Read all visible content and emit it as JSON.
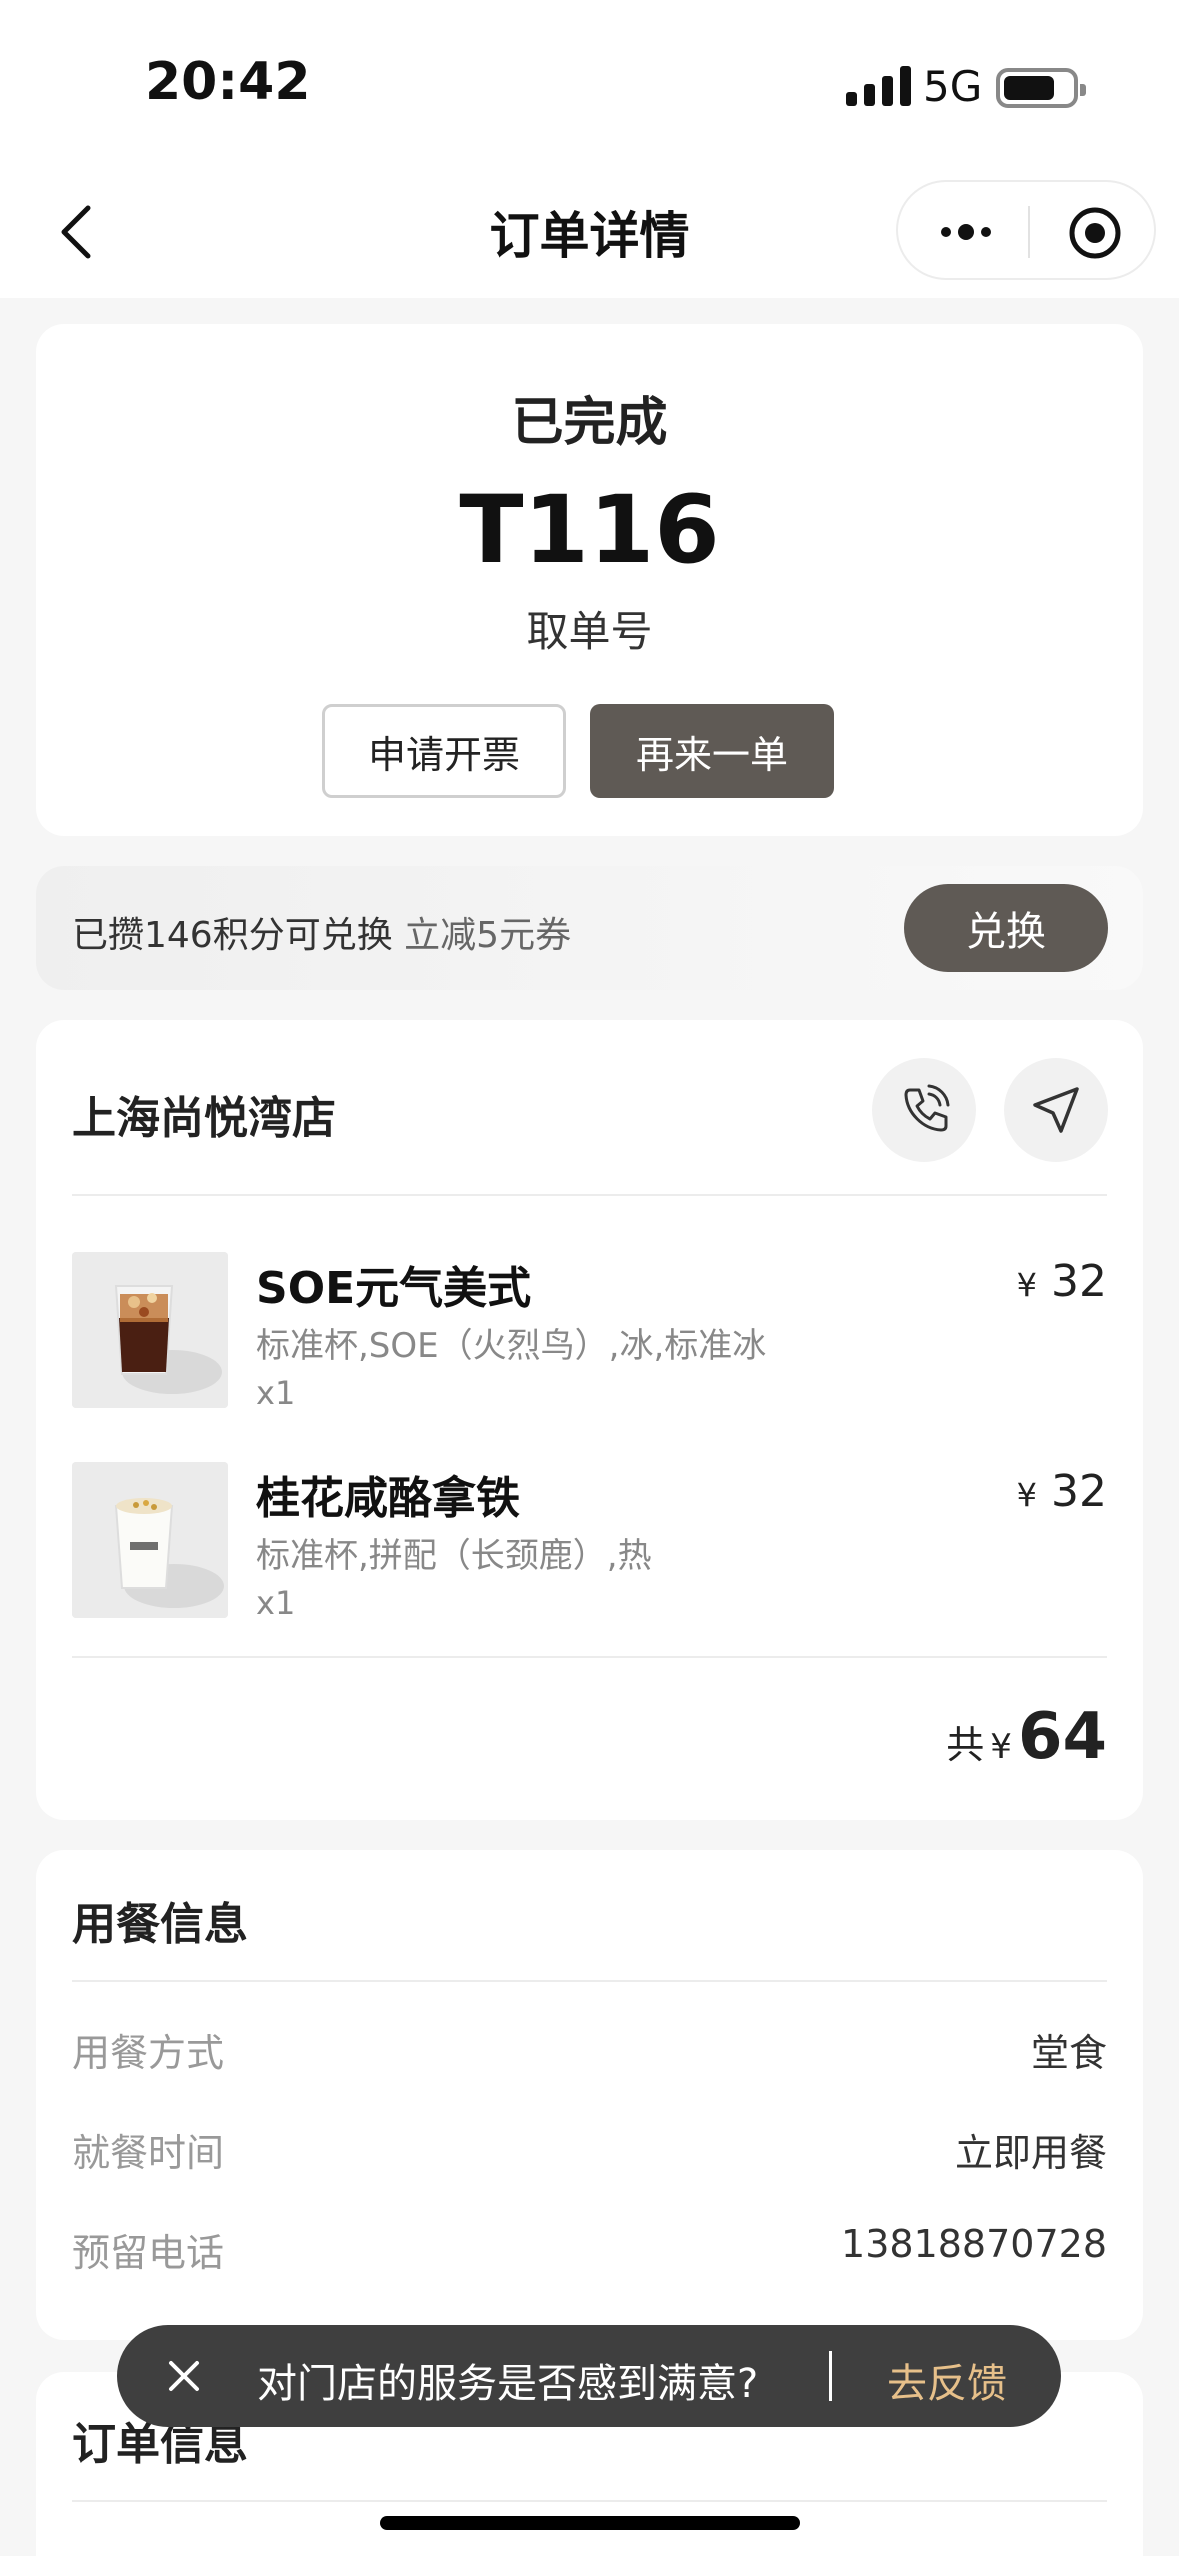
{
  "status_bar": {
    "time": "20:42",
    "network": "5G"
  },
  "nav": {
    "title": "订单详情"
  },
  "order_status": {
    "status": "已完成",
    "pickup_number": "T116",
    "pickup_label": "取单号",
    "invoice_button": "申请开票",
    "reorder_button": "再来一单"
  },
  "points": {
    "text": "已攒146积分可兑换",
    "reward": " 立减5元券",
    "redeem_button": "兑换"
  },
  "store": {
    "name": "上海尚悦湾店",
    "items": [
      {
        "name": "SOE元气美式",
        "spec": "标准杯,SOE（火烈鸟）,冰,标准冰",
        "qty": "x1",
        "currency": "¥",
        "price": "32"
      },
      {
        "name": "桂花咸酪拿铁",
        "spec": "标准杯,拼配（长颈鹿）,热",
        "qty": "x1",
        "currency": "¥",
        "price": "32"
      }
    ],
    "total_label": "共",
    "total_currency": "¥",
    "total_amount": "64"
  },
  "dining_info": {
    "title": "用餐信息",
    "rows": [
      {
        "label": "用餐方式",
        "value": "堂食"
      },
      {
        "label": "就餐时间",
        "value": "立即用餐"
      },
      {
        "label": "预留电话",
        "value": "13818870728"
      }
    ]
  },
  "order_info": {
    "title": "订单信息"
  },
  "toast": {
    "text": "对门店的服务是否感到满意?",
    "link": "去反馈"
  },
  "colors": {
    "accent_dark": "#5f5a55",
    "toast_link": "#e7c08a"
  }
}
